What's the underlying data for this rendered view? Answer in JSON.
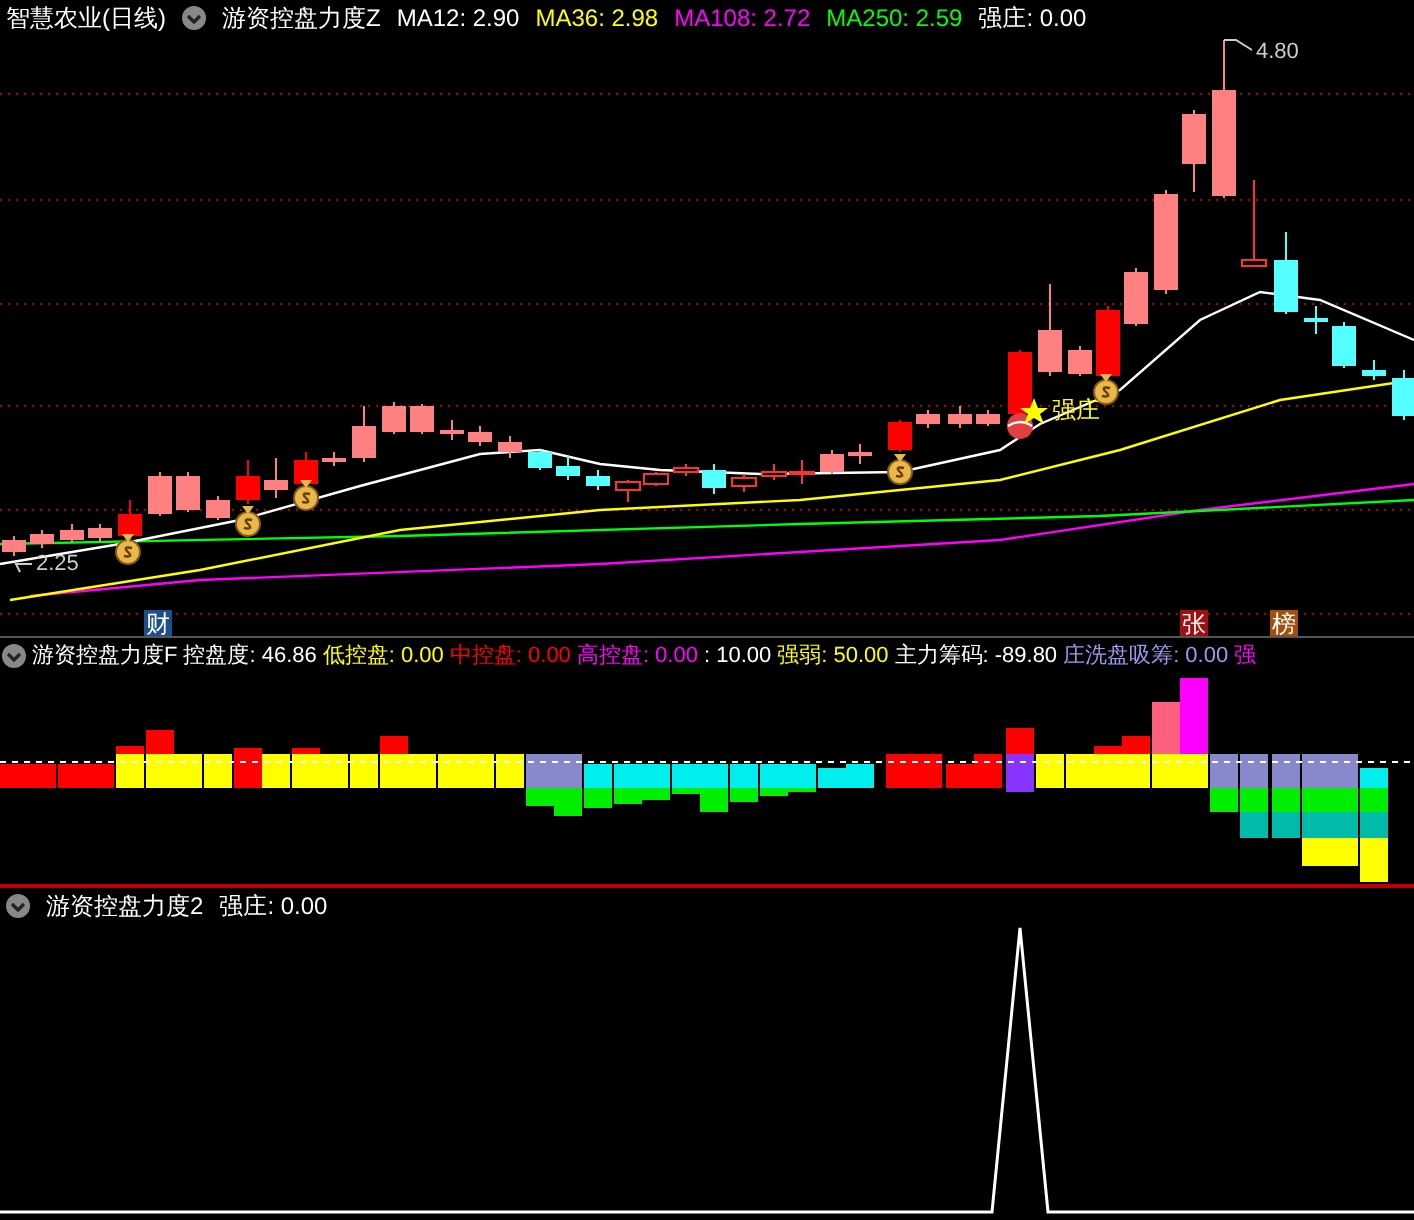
{
  "main_panel": {
    "title": "智慧农业(日线)",
    "indicator": "游资控盘力度Z",
    "legend": [
      {
        "label": "MA12: 2.90",
        "color": "#ffffff"
      },
      {
        "label": "MA36: 2.98",
        "color": "#ffff00"
      },
      {
        "label": "MA108: 2.72",
        "color": "#ff00ff"
      },
      {
        "label": "MA250: 2.59",
        "color": "#00ff00"
      },
      {
        "label": "强庄: 0.00",
        "color": "#ffffff"
      }
    ],
    "high_label": "4.80",
    "low_label": "2.25",
    "signal_label": "强庄",
    "markers": [
      {
        "text": "财",
        "color": "#1d4f8a"
      },
      {
        "text": "张",
        "color": "#a01010"
      },
      {
        "text": "榜",
        "color": "#a0500a"
      }
    ]
  },
  "control_panel": {
    "indicator": "游资控盘力度F",
    "legend": [
      {
        "label": "控盘度: 46.86",
        "color": "#ffffff"
      },
      {
        "label": "低控盘: 0.00",
        "color": "#ffff00"
      },
      {
        "label": "中控盘: 0.00",
        "color": "#ff0000"
      },
      {
        "label": "高控盘: 0.00",
        "color": "#ff00ff"
      },
      {
        "label": ": 10.00",
        "color": "#ffffff"
      },
      {
        "label": "强弱: 50.00",
        "color": "#ffff00"
      },
      {
        "label": "主力筹码: -89.80",
        "color": "#ffffff"
      },
      {
        "label": "庄洗盘吸筹: 0.00",
        "color": "#9999ee"
      },
      {
        "label": "强",
        "color": "#ff00ff"
      }
    ]
  },
  "strength_panel": {
    "indicator": "游资控盘力度2",
    "legend": [
      {
        "label": "强庄: 0.00",
        "color": "#ffffff"
      }
    ]
  }
}
